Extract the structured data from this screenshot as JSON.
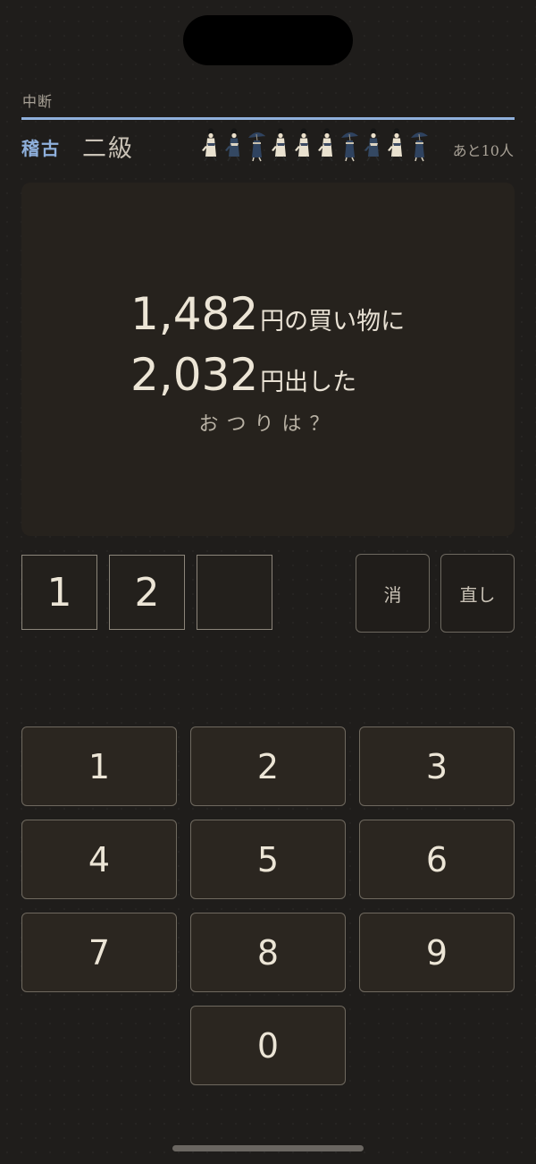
{
  "header": {
    "abort_label": "中断",
    "mode_label": "稽古",
    "grade_label": "二級",
    "remaining_label": "あと10人",
    "progress_fraction": 1.0
  },
  "customers": [
    {
      "type": "walker-light"
    },
    {
      "type": "walker-dark"
    },
    {
      "type": "umbrella"
    },
    {
      "type": "walker-light"
    },
    {
      "type": "walker-light"
    },
    {
      "type": "walker-light"
    },
    {
      "type": "umbrella"
    },
    {
      "type": "walker-dark"
    },
    {
      "type": "walker-light"
    },
    {
      "type": "umbrella"
    }
  ],
  "problem": {
    "price": "1,482",
    "price_suffix": "円の買い物に",
    "paid": "2,032",
    "paid_suffix": "円出した",
    "question": "おつりは？"
  },
  "answer": {
    "digits": [
      "1",
      "2",
      ""
    ]
  },
  "actions": {
    "clear_label": "消",
    "reset_label": "直し"
  },
  "keypad": [
    "1",
    "2",
    "3",
    "4",
    "5",
    "6",
    "7",
    "8",
    "9",
    "0"
  ],
  "colors": {
    "accent": "#8fb0dc",
    "background": "#1f1d1b",
    "card": "#26221d",
    "key": "#2b2620",
    "text": "#ece5d6"
  }
}
